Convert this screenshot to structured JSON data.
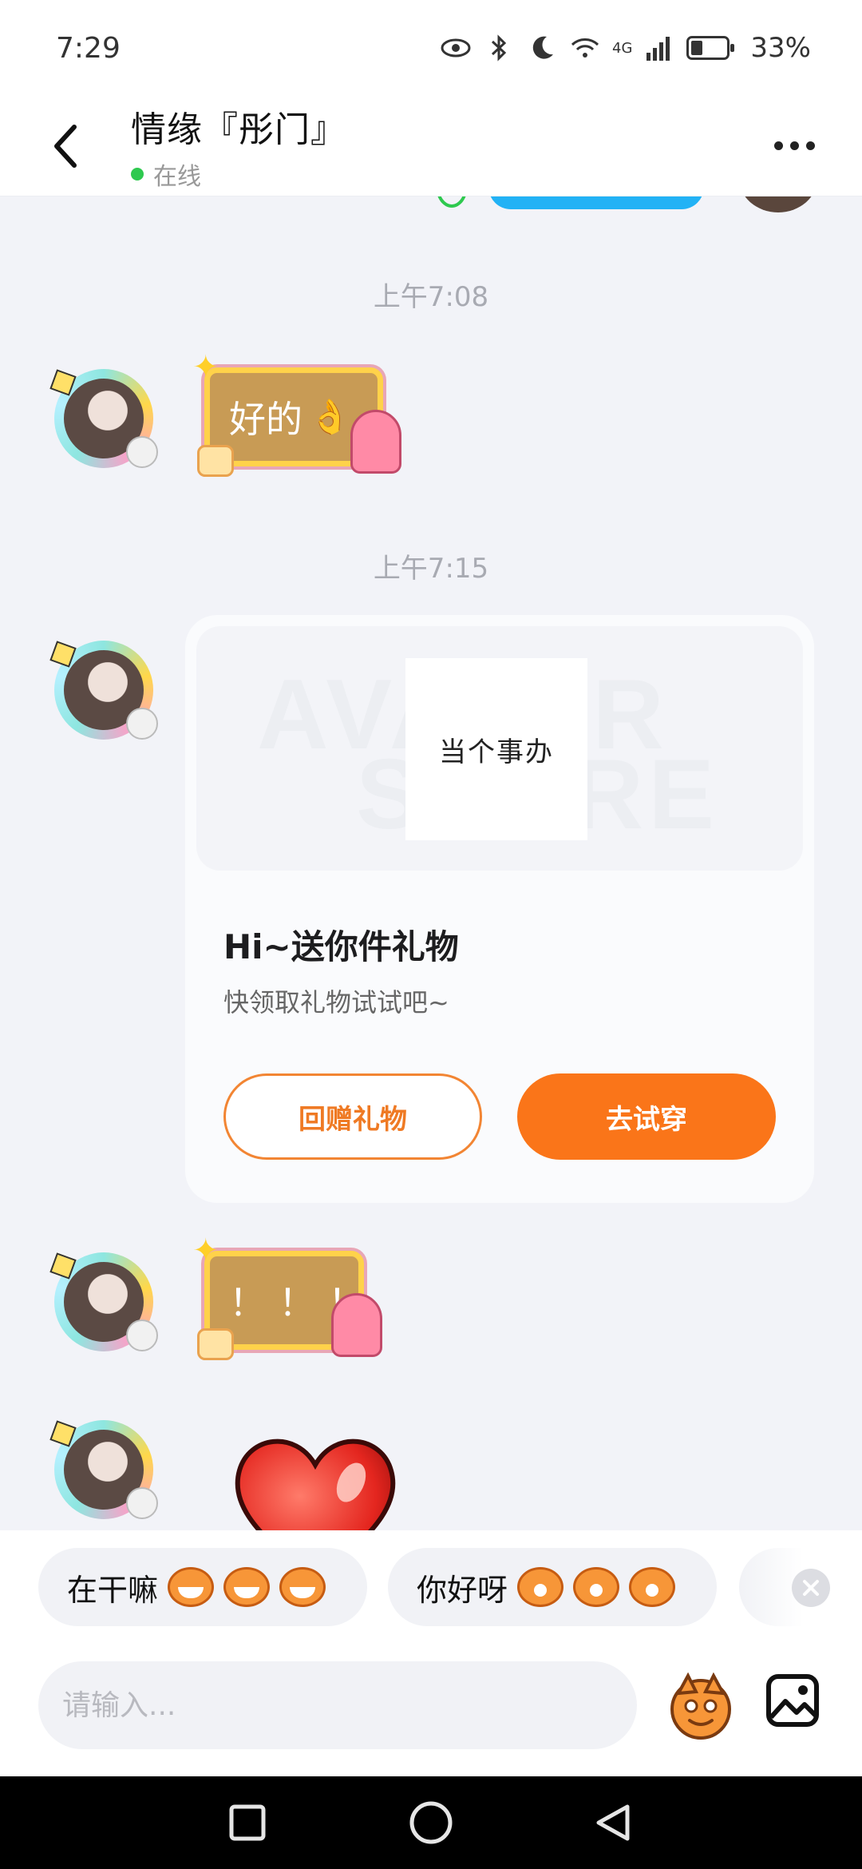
{
  "status_bar": {
    "time": "7:29",
    "network": "4G",
    "battery": "33%"
  },
  "header": {
    "contact_name": "情缘『彤门』",
    "presence": "在线"
  },
  "chat": {
    "timestamps": [
      "上午7:08",
      "上午7:15"
    ],
    "messages": [
      {
        "type": "sticker_text",
        "text": "好的",
        "emoji": "👌"
      },
      {
        "type": "gift_card",
        "thumbnail_text": "当个事办",
        "watermark_top": "AVATAR",
        "watermark_bottom": "STORE",
        "title": "Hi~送你件礼物",
        "subtitle": "快领取礼物试试吧~",
        "return_label": "回赠礼物",
        "try_label": "去试穿"
      },
      {
        "type": "sticker_text",
        "text": "！！！"
      },
      {
        "type": "sticker_heart"
      }
    ]
  },
  "quick_replies": [
    {
      "text": "在干嘛"
    },
    {
      "text": "你好呀"
    }
  ],
  "input": {
    "placeholder": "请输入..."
  },
  "colors": {
    "accent": "#fa7519",
    "online": "#2ec94f",
    "sticker_gold": "#c89b55"
  },
  "icons": [
    "back-arrow-icon",
    "more-dots-icon",
    "close-icon",
    "emoji-icon",
    "image-icon",
    "nav-square-icon",
    "nav-circle-icon",
    "nav-back-icon"
  ]
}
